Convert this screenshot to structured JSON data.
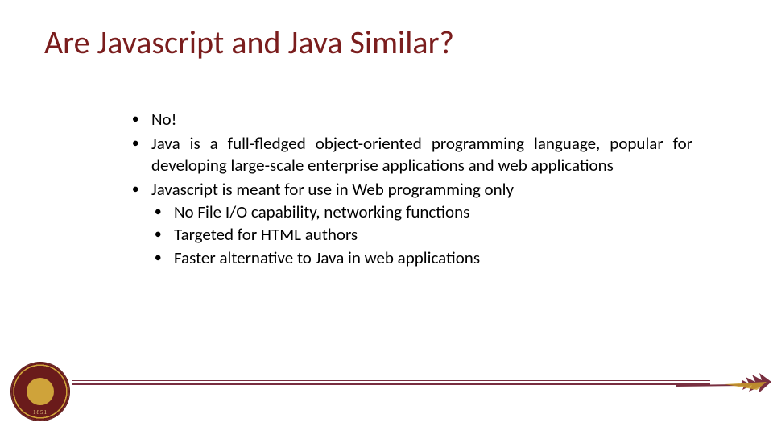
{
  "title": "Are Javascript and Java Similar?",
  "bullets": {
    "b1": "No!",
    "b2": "Java is a full-fledged object-oriented programming language, popular for developing large-scale enterprise applications and web applications",
    "b3": "Javascript is meant for use in Web programming only",
    "b3_sub": {
      "s1": "No File I/O capability, networking functions",
      "s2": "Targeted for HTML authors",
      "s3": "Faster alternative to Java in web applications"
    }
  },
  "seal": {
    "year": "1851"
  },
  "colors": {
    "garnet": "#782f40",
    "gold": "#cfa33a"
  }
}
